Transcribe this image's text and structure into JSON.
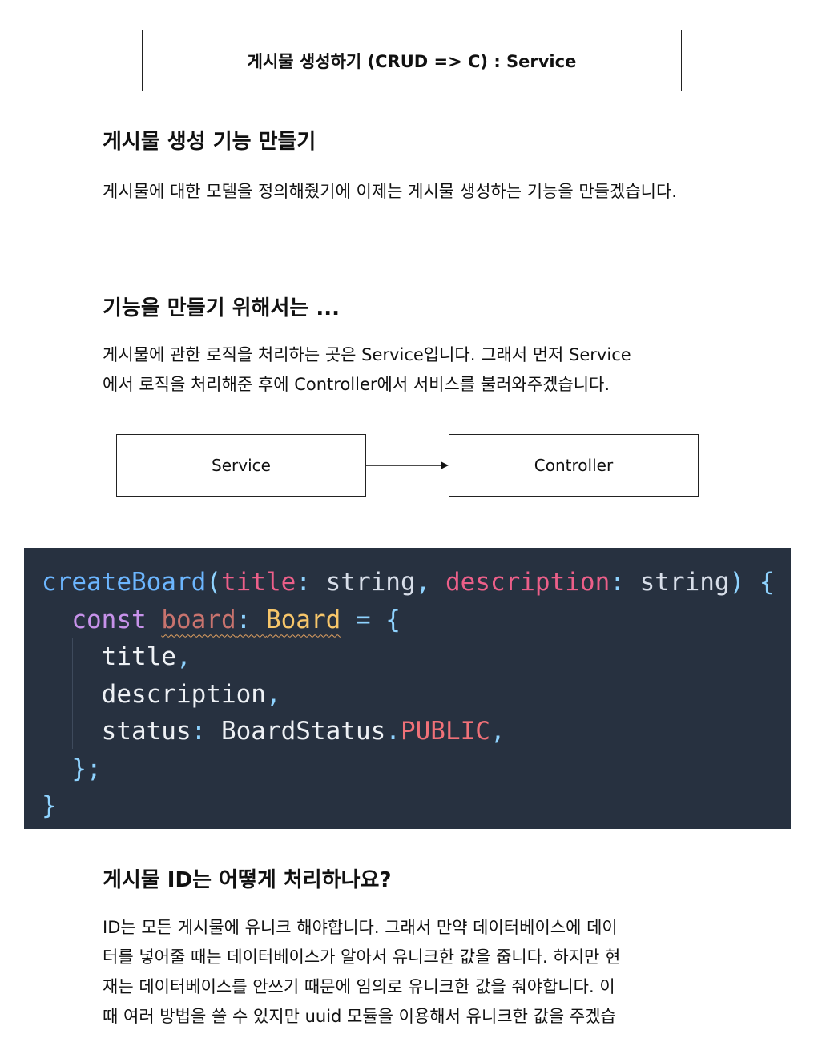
{
  "header_title": "게시물 생성하기 (CRUD => C) : Service",
  "section1": {
    "heading": "게시물 생성 기능 만들기",
    "paragraph": "게시물에 대한 모델을 정의해줬기에 이제는 게시물 생성하는 기능을 만들겠습니다."
  },
  "section2": {
    "heading": "기능을 만들기 위해서는 ...",
    "paragraph_line1": "게시물에 관한 로직을 처리하는 곳은 Service입니다. 그래서 먼저 Service",
    "paragraph_line2": "에서 로직을 처리해준 후에 Controller에서 서비스를 불러와주겠습니다."
  },
  "flow": {
    "from": "Service",
    "to": "Controller"
  },
  "code": {
    "fn_name": "createBoard",
    "param1": "title",
    "param2": "description",
    "type_string": "string",
    "kw_const": "const",
    "var_board": "board",
    "class_board": "Board",
    "prop_title": "title",
    "prop_description": "description",
    "prop_status": "status",
    "enum_name": "BoardStatus",
    "enum_value": "PUBLIC"
  },
  "section3": {
    "heading": "게시물 ID는 어떻게 처리하나요?",
    "line1": "ID는 모든 게시물에 유니크 해야합니다. 그래서 만약 데이터베이스에 데이",
    "line2": "터를 넣어줄 때는 데이터베이스가 알아서 유니크한 값을 줍니다. 하지만 현",
    "line3": "재는 데이터베이스를 안쓰기 때문에 임의로 유니크한 값을 줘야합니다. 이",
    "line4": "때 여러 방법을 쓸 수 있지만 uuid 모듈을 이용해서 유니크한 값을 주겠습"
  }
}
